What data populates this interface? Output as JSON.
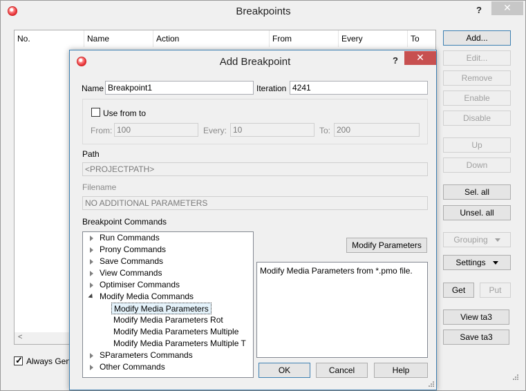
{
  "outer": {
    "title": "Breakpoints",
    "help": "?",
    "close": "✕",
    "columns": [
      "No.",
      "Name",
      "Action",
      "From",
      "Every",
      "To"
    ],
    "scroll_left": "<",
    "always_label": "Always Gener",
    "buttons": {
      "add": "Add...",
      "edit": "Edit...",
      "remove": "Remove",
      "enable": "Enable",
      "disable": "Disable",
      "up": "Up",
      "down": "Down",
      "sel_all": "Sel. all",
      "unsel_all": "Unsel. all",
      "grouping": "Grouping",
      "settings": "Settings",
      "get": "Get",
      "put": "Put",
      "view_ta3": "View ta3",
      "save_ta3": "Save ta3"
    }
  },
  "dialog": {
    "title": "Add Breakpoint",
    "help": "?",
    "close": "✕",
    "name_label": "Name",
    "name_value": "Breakpoint1",
    "iteration_label": "Iteration",
    "iteration_value": "4241",
    "use_from_to": "Use from to",
    "from_label": "From:",
    "from_value": "100",
    "every_label": "Every:",
    "every_value": "10",
    "to_label": "To:",
    "to_value": "200",
    "path_label": "Path",
    "path_value": "<PROJECTPATH>",
    "filename_label": "Filename",
    "filename_value": "NO ADDITIONAL PARAMETERS",
    "commands_label": "Breakpoint Commands",
    "tree": [
      "Run Commands",
      "Prony Commands",
      "Save Commands",
      "View Commands",
      "Optimiser Commands",
      "Modify Media Commands",
      "Modify Media Parameters",
      "Modify Media Parameters Rot",
      "Modify Media Parameters Multiple",
      "Modify Media Parameters Multiple T",
      "SParameters Commands",
      "Other Commands"
    ],
    "modify_params_button": "Modify Parameters",
    "description": "Modify Media Parameters from *.pmo file.",
    "ok": "OK",
    "cancel": "Cancel",
    "help_button": "Help"
  }
}
